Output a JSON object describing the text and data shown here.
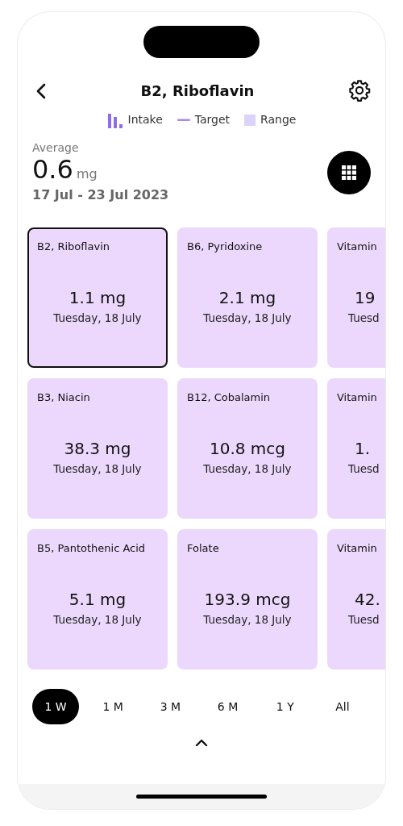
{
  "header": {
    "title": "B2, Riboflavin"
  },
  "legend": [
    {
      "kind": "bars",
      "label": "Intake"
    },
    {
      "kind": "line",
      "label": "Target"
    },
    {
      "kind": "square",
      "label": "Range"
    }
  ],
  "summary": {
    "label": "Average",
    "value": "0.6",
    "unit": "mg",
    "date_range": "17 Jul - 23 Jul 2023"
  },
  "cards": [
    {
      "kind": "full",
      "name": "B2, Riboflavin",
      "value": "1.1 mg",
      "date": "Tuesday, 18 July",
      "selected": true
    },
    {
      "kind": "full",
      "name": "B6, Pyridoxine",
      "value": "2.1 mg",
      "date": "Tuesday, 18 July",
      "selected": false
    },
    {
      "kind": "clipped",
      "name": "Vitamin",
      "value": "19",
      "date": "Tuesd",
      "selected": false
    },
    {
      "kind": "full",
      "name": "B3, Niacin",
      "value": "38.3 mg",
      "date": "Tuesday, 18 July",
      "selected": false
    },
    {
      "kind": "full",
      "name": "B12, Cobalamin",
      "value": "10.8 mcg",
      "date": "Tuesday, 18 July",
      "selected": false
    },
    {
      "kind": "clipped",
      "name": "Vitamin",
      "value": "1.",
      "date": "Tuesd",
      "selected": false
    },
    {
      "kind": "full",
      "name": "B5, Pantothenic Acid",
      "value": "5.1 mg",
      "date": "Tuesday, 18 July",
      "selected": false
    },
    {
      "kind": "full",
      "name": "Folate",
      "value": "193.9 mcg",
      "date": "Tuesday, 18 July",
      "selected": false
    },
    {
      "kind": "clipped",
      "name": "Vitamin",
      "value": "42.",
      "date": "Tuesd",
      "selected": false
    }
  ],
  "ranges": [
    {
      "label": "1 W",
      "selected": true
    },
    {
      "label": "1 M",
      "selected": false
    },
    {
      "label": "3 M",
      "selected": false
    },
    {
      "label": "6 M",
      "selected": false
    },
    {
      "label": "1 Y",
      "selected": false
    },
    {
      "label": "All",
      "selected": false
    }
  ]
}
